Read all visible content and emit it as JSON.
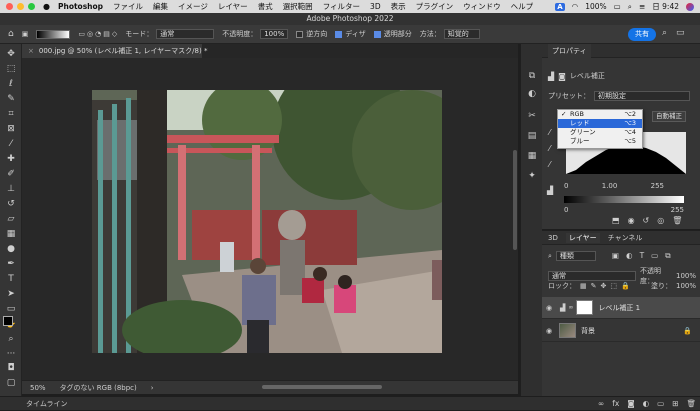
{
  "menubar": {
    "app": "Photoshop",
    "items": [
      "ファイル",
      "編集",
      "イメージ",
      "レイヤー",
      "書式",
      "選択範囲",
      "フィルター",
      "3D",
      "表示",
      "プラグイン",
      "ウィンドウ",
      "ヘルプ"
    ],
    "input_source": "A",
    "battery": "100%",
    "clock": "日 9:42"
  },
  "window": {
    "title": "Adobe Photoshop 2022"
  },
  "options": {
    "mode_label": "モード：",
    "mode_value": "通常",
    "opacity_label": "不透明度：",
    "opacity_value": "100%",
    "reverse_label": "逆方向",
    "dither_label": "ディザ",
    "transparency_label": "透明部分",
    "method_label": "方法：",
    "method_value": "知覚的",
    "share": "共有"
  },
  "document": {
    "tab": "000.jpg @ 50% (レベル補正 1, レイヤーマスク/8) *"
  },
  "status": {
    "zoom": "50%",
    "profile": "タグのない RGB (8bpc)"
  },
  "timeline": {
    "label": "タイムライン"
  },
  "properties": {
    "tab": "プロパティ",
    "adj_name": "レベル補正",
    "preset_label": "プリセット：",
    "preset_value": "初期設定",
    "auto_button": "自動補正",
    "channel_menu": [
      {
        "label": "RGB",
        "shortcut": "⌥2",
        "checked": true,
        "highlight": false
      },
      {
        "label": "レッド",
        "shortcut": "⌥3",
        "checked": false,
        "highlight": true
      },
      {
        "label": "グリーン",
        "shortcut": "⌥4",
        "checked": false,
        "highlight": false
      },
      {
        "label": "ブルー",
        "shortcut": "⌥5",
        "checked": false,
        "highlight": false
      }
    ],
    "input_levels": [
      "0",
      "1.00",
      "255"
    ],
    "output_levels": [
      "0",
      "255"
    ]
  },
  "layers_panel": {
    "tabs": [
      "3D",
      "レイヤー",
      "チャンネル"
    ],
    "filter_value": "種類",
    "blend_mode": "通常",
    "opacity_label": "不透明度：",
    "opacity_value": "100%",
    "lock_label": "ロック：",
    "fill_label": "塗り：",
    "fill_value": "100%",
    "layers": [
      {
        "name": "レベル補正 1",
        "selected": true
      },
      {
        "name": "背景",
        "selected": false
      }
    ]
  }
}
